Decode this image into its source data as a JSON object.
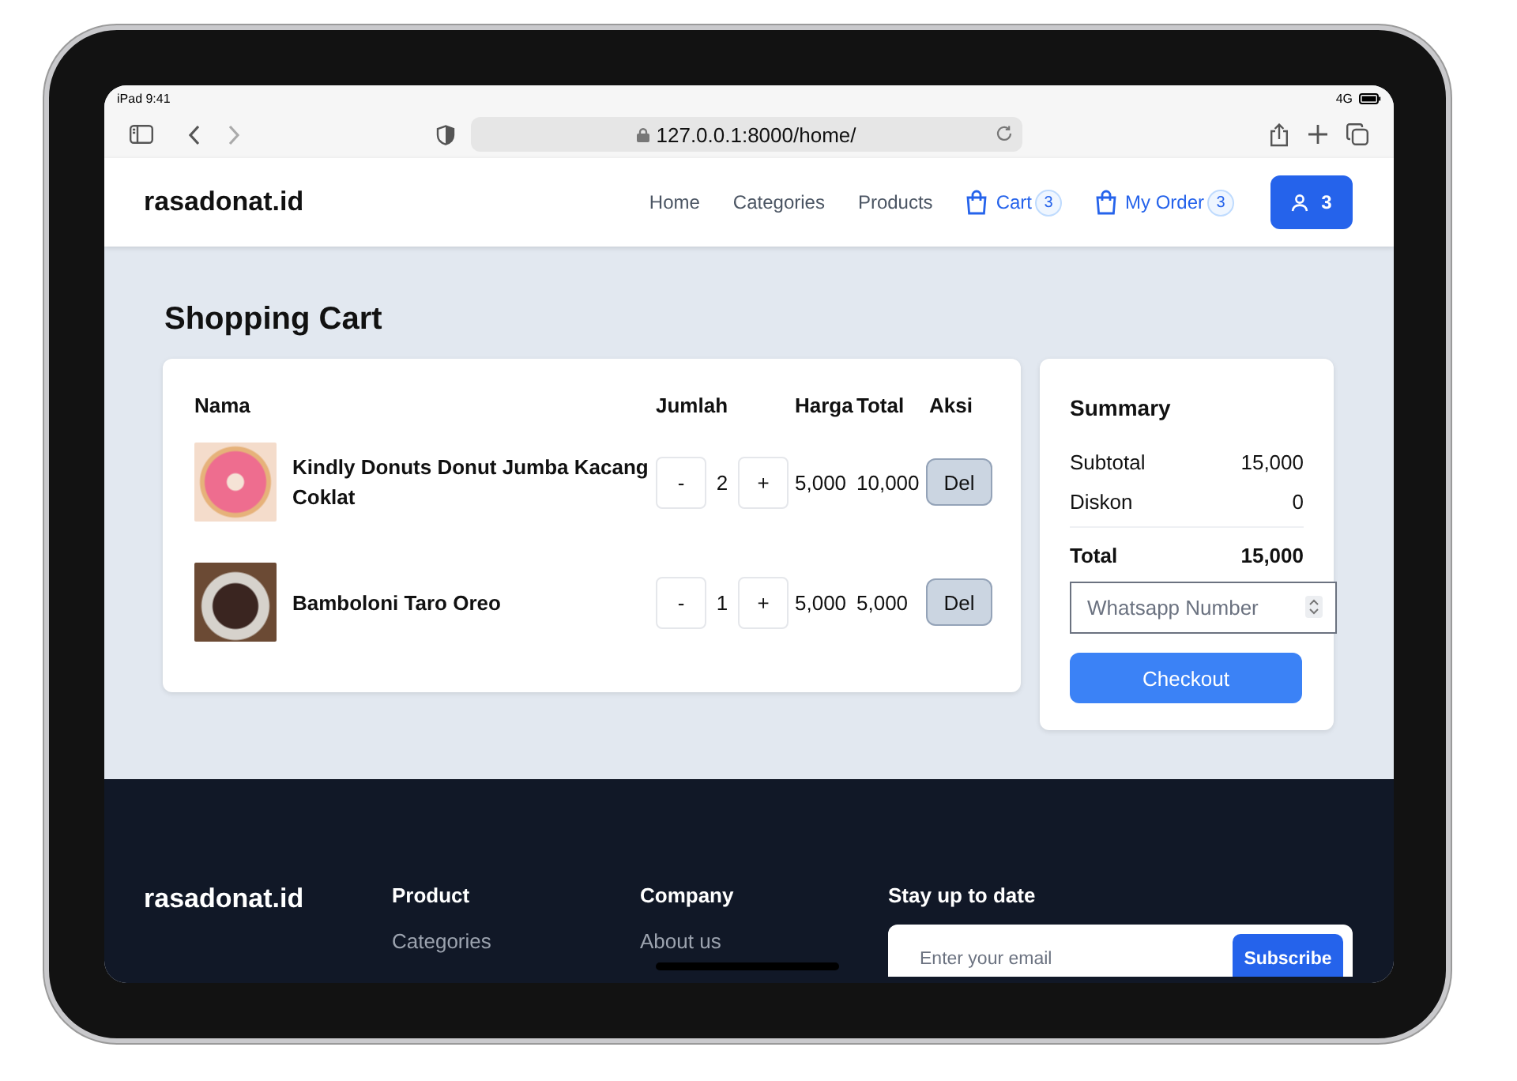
{
  "status_bar": {
    "left": "iPad 9:41",
    "network": "4G"
  },
  "browser": {
    "url": "127.0.0.1:8000/home/"
  },
  "navbar": {
    "brand": "rasadonat.id",
    "links": [
      "Home",
      "Categories",
      "Products"
    ],
    "cart": {
      "label": "Cart",
      "count": "3"
    },
    "my_order": {
      "label": "My Order",
      "count": "3"
    },
    "user_button": {
      "count": "3"
    }
  },
  "page": {
    "title": "Shopping Cart"
  },
  "cart": {
    "columns": [
      "Nama",
      "Jumlah",
      "Harga",
      "Total",
      "Aksi"
    ],
    "rows": [
      {
        "name": "Kindly Donuts Donut Jumba Kacang Coklat",
        "minus": "-",
        "quantity": "2",
        "plus": "+",
        "price": "5,000",
        "total": "10,000",
        "delete": "Del"
      },
      {
        "name": "Bamboloni Taro Oreo",
        "minus": "-",
        "quantity": "1",
        "plus": "+",
        "price": "5,000",
        "total": "5,000",
        "delete": "Del"
      }
    ]
  },
  "summary": {
    "title": "Summary",
    "lines": [
      {
        "label": "Subtotal",
        "value": "15,000"
      },
      {
        "label": "Diskon",
        "value": "0"
      }
    ],
    "total": {
      "label": "Total",
      "value": "15,000"
    },
    "phone_field": {
      "placeholder": "Whatsapp Number"
    },
    "checkout": "Checkout"
  },
  "footer": {
    "brand": "rasadonat.id",
    "columns": [
      {
        "title": "Product",
        "links": [
          "Categories"
        ]
      },
      {
        "title": "Company",
        "links": [
          "About us"
        ]
      }
    ],
    "newsletter": {
      "title": "Stay up to date",
      "email": {
        "placeholder": "Enter your email"
      },
      "button": "Subscribe"
    }
  }
}
